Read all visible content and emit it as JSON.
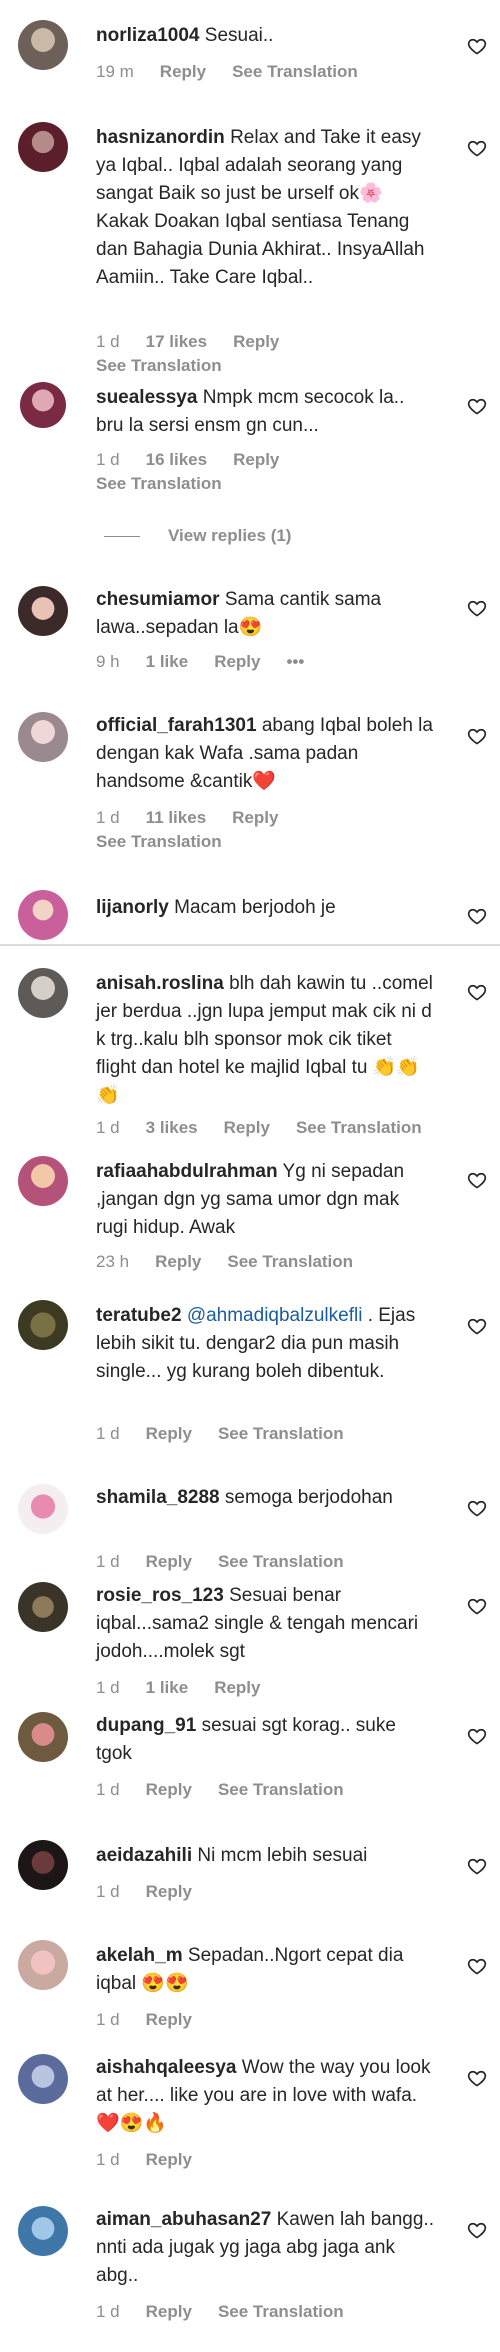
{
  "labels": {
    "reply": "Reply",
    "see_translation": "See Translation",
    "view_replies": "View replies (1)"
  },
  "comments": [
    {
      "username": "norliza1004",
      "text": "Sesuai..",
      "time": "19 m",
      "likes": ""
    },
    {
      "username": "hasnizanordin",
      "text": "Relax and Take it easy ya Iqbal.. Iqbal adalah seorang yang sangat Baik so just be urself ok🌸 Kakak Doakan Iqbal sentiasa Tenang dan Bahagia Dunia Akhirat.. InsyaAllah Aamiin.. Take Care Iqbal..",
      "time": "1 d",
      "likes": "17 likes"
    },
    {
      "username": "suealessya",
      "text": "Nmpk mcm secocok la.. bru la sersi ensm gn cun...",
      "time": "1 d",
      "likes": "16 likes"
    },
    {
      "username": "chesumiamor",
      "text": "Sama cantik sama lawa..sepadan la😍",
      "time": "9 h",
      "likes": "1 like",
      "more": "•••"
    },
    {
      "username": "official_farah1301",
      "text": "abang Iqbal boleh la dengan kak Wafa .sama padan handsome &cantik❤️",
      "time": "1 d",
      "likes": "11 likes"
    },
    {
      "username": "lijanorly",
      "text": "Macam berjodoh je"
    },
    {
      "username": "anisah.roslina",
      "text": "blh dah kawin tu ..comel jer berdua ..jgn lupa jemput mak cik ni d k trg..kalu blh sponsor mok cik tiket flight dan hotel ke majlid Iqbal tu 👏👏👏",
      "time": "1 d",
      "likes": "3 likes"
    },
    {
      "username": "rafiaahabdulrahman",
      "text": "Yg ni sepadan ,jangan dgn yg sama umor dgn mak rugi hidup. Awak",
      "time": "23 h",
      "likes": ""
    },
    {
      "username": "teratube2",
      "mention": "@ahmadiqbalzulkefli",
      "text": ". Ejas lebih sikit tu. dengar2 dia pun masih single... yg kurang boleh dibentuk.",
      "time": "1 d",
      "likes": ""
    },
    {
      "username": "shamila_8288",
      "text": "semoga berjodohan",
      "time": "1 d",
      "likes": ""
    },
    {
      "username": "rosie_ros_123",
      "text": "Sesuai benar iqbal...sama2 single & tengah mencari jodoh....molek sgt",
      "time": "1 d",
      "likes": "1 like"
    },
    {
      "username": "dupang_91",
      "text": "sesuai sgt korag.. suke tgok",
      "time": "1 d",
      "likes": ""
    },
    {
      "username": "aeidazahili",
      "text": "Ni mcm lebih sesuai",
      "time": "1 d",
      "likes": ""
    },
    {
      "username": "akelah_m",
      "text": "Sepadan..Ngort cepat dia iqbal 😍😍",
      "time": "1 d",
      "likes": ""
    },
    {
      "username": "aishahqaleesya",
      "text": "Wow the way you look at her.... like you are in love with wafa.❤️😍🔥",
      "time": "1 d",
      "likes": ""
    },
    {
      "username": "aiman_abuhasan27",
      "text": "Kawen lah bangg.. nnti ada jugak yg jaga abg jaga ank abg..",
      "time": "1 d",
      "likes": ""
    }
  ],
  "colors": {
    "text": "#262626",
    "muted": "#8e8e8e",
    "mention": "#1a5c9e",
    "divider": "#dbdbdb"
  },
  "icons": {
    "like": "heart-outline-icon"
  }
}
